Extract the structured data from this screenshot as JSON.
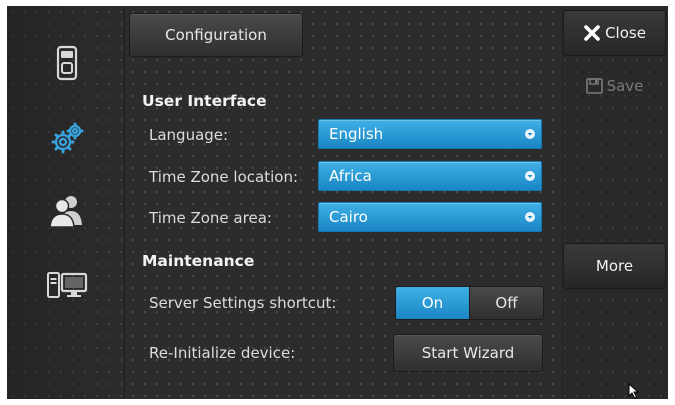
{
  "sidebar": {
    "items": [
      {
        "icon": "touch-panel-icon"
      },
      {
        "icon": "settings-gears-icon",
        "selected": true
      },
      {
        "icon": "users-icon"
      },
      {
        "icon": "computer-display-icon"
      }
    ]
  },
  "header": {
    "title": "Configuration"
  },
  "user_interface": {
    "section_title": "User Interface",
    "language": {
      "label": "Language:",
      "value": "English"
    },
    "tz_location": {
      "label": "Time Zone location:",
      "value": "Africa"
    },
    "tz_area": {
      "label": "Time Zone area:",
      "value": "Cairo"
    }
  },
  "maintenance": {
    "section_title": "Maintenance",
    "server_shortcut": {
      "label": "Server Settings shortcut:",
      "on_label": "On",
      "off_label": "Off",
      "selected": "On"
    },
    "reinit": {
      "label": "Re-Initialize device:",
      "button_label": "Start Wizard"
    }
  },
  "right_panel": {
    "close_label": "Close",
    "save_label": "Save",
    "more_label": "More"
  },
  "colors": {
    "accent": "#1f95d4",
    "background": "#2c2c2c",
    "icon_accent": "#3aa0dc"
  }
}
